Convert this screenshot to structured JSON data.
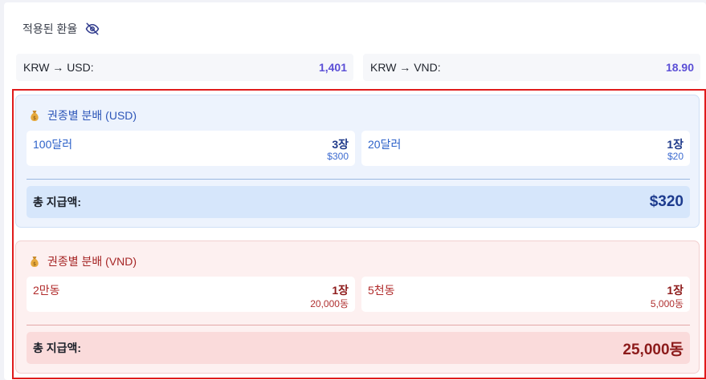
{
  "rates": {
    "header_label": "적용된 환율",
    "header_icon": "eye-off-icon",
    "items": [
      {
        "pair": "KRW → USD:",
        "value": "1,401"
      },
      {
        "pair": "KRW → VND:",
        "value": "18.90"
      }
    ]
  },
  "usd": {
    "title": "권종별 분배 (USD)",
    "icon": "money-bag-icon",
    "bills": [
      {
        "name": "100달러",
        "count": "3장",
        "amount": "$300"
      },
      {
        "name": "20달러",
        "count": "1장",
        "amount": "$20"
      }
    ],
    "total_label": "총 지급액:",
    "total_value": "$320"
  },
  "vnd": {
    "title": "권종별 분배 (VND)",
    "icon": "money-bag-icon",
    "bills": [
      {
        "name": "2만동",
        "count": "1장",
        "amount": "20,000동"
      },
      {
        "name": "5천동",
        "count": "1장",
        "amount": "5,000동"
      }
    ],
    "total_label": "총 지급액:",
    "total_value": "25,000동"
  },
  "colors": {
    "accent_rate": "#5b4fd6",
    "highlight_border": "#e01b1b",
    "usd_bg": "#edf3fd",
    "vnd_bg": "#fdf0f0"
  }
}
